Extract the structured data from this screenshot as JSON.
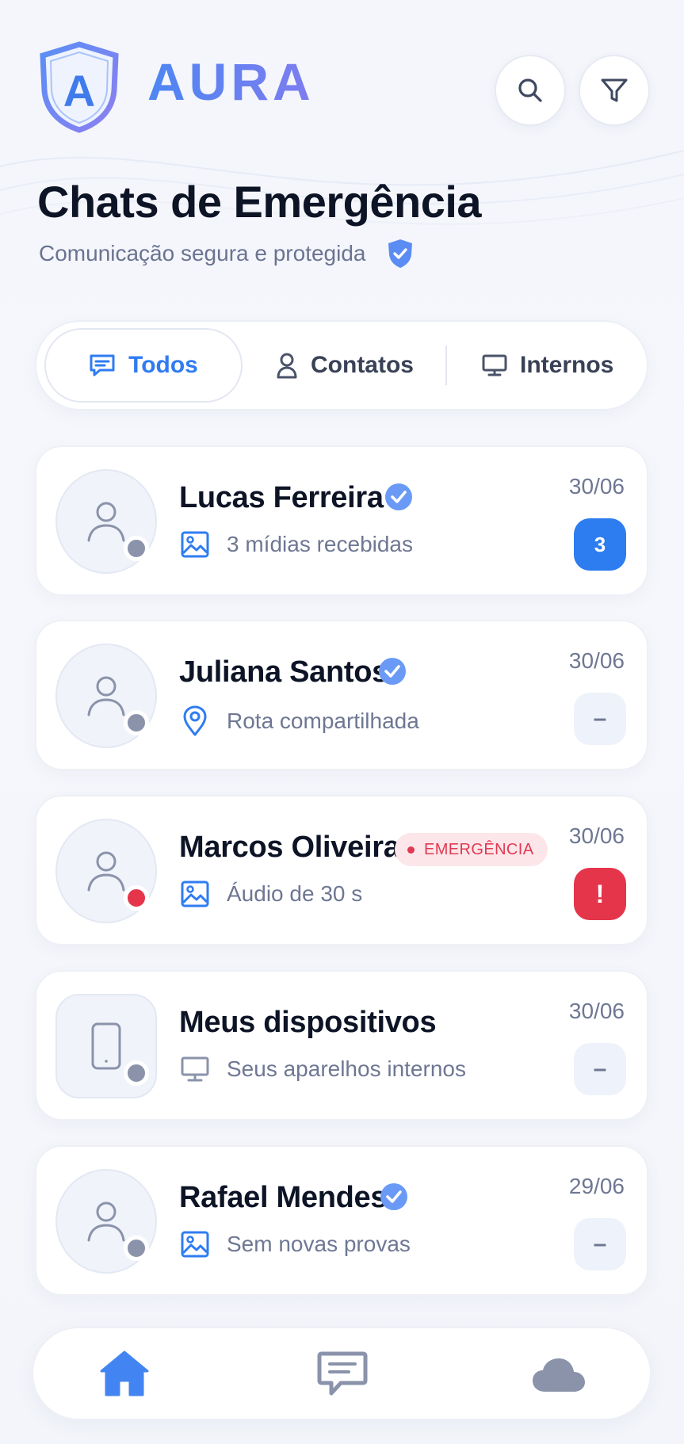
{
  "app": {
    "brand": "AURA"
  },
  "header": {
    "title": "Chats de Emergência",
    "subtitle": "Comunicação segura e protegida"
  },
  "tabs": [
    {
      "label": "Todos",
      "icon": "chat-icon",
      "active": true
    },
    {
      "label": "Contatos",
      "icon": "person-icon",
      "active": false
    },
    {
      "label": "Internos",
      "icon": "monitor-icon",
      "active": false
    }
  ],
  "chats": [
    {
      "name": "Lucas Ferreira",
      "verified": true,
      "preview": "3 mídias recebidas",
      "preview_icon": "image-icon",
      "date": "30/06",
      "badge": "3",
      "badge_type": "count",
      "status": "offline"
    },
    {
      "name": "Juliana Santos",
      "verified": true,
      "preview": "Rota compartilhada",
      "preview_icon": "location-pin-icon",
      "date": "30/06",
      "badge": "–",
      "badge_type": "empty",
      "status": "offline"
    },
    {
      "name": "Marcos Oliveira",
      "verified": false,
      "tag": "EMERGÊNCIA",
      "preview": "Áudio de 30 s",
      "preview_icon": "image-icon",
      "date": "30/06",
      "badge": "!",
      "badge_type": "alert",
      "status": "emergency"
    },
    {
      "name": "Meus dispositivos",
      "verified": false,
      "preview": "Seus aparelhos internos",
      "preview_icon": "monitor-icon",
      "date": "30/06",
      "badge": "–",
      "badge_type": "empty",
      "status": "offline"
    },
    {
      "name": "Rafael Mendes",
      "verified": true,
      "preview": "Sem novas provas",
      "preview_icon": "image-icon",
      "date": "29/06",
      "badge": "–",
      "badge_type": "empty",
      "status": "offline"
    }
  ],
  "bottom_nav": [
    {
      "icon": "home-icon",
      "active": true
    },
    {
      "icon": "chat-bubble-icon",
      "active": false
    },
    {
      "icon": "cloud-icon",
      "active": false
    }
  ],
  "colors": {
    "accent": "#2f7cf2",
    "emergency": "#e5354a",
    "muted": "#6e7793"
  }
}
